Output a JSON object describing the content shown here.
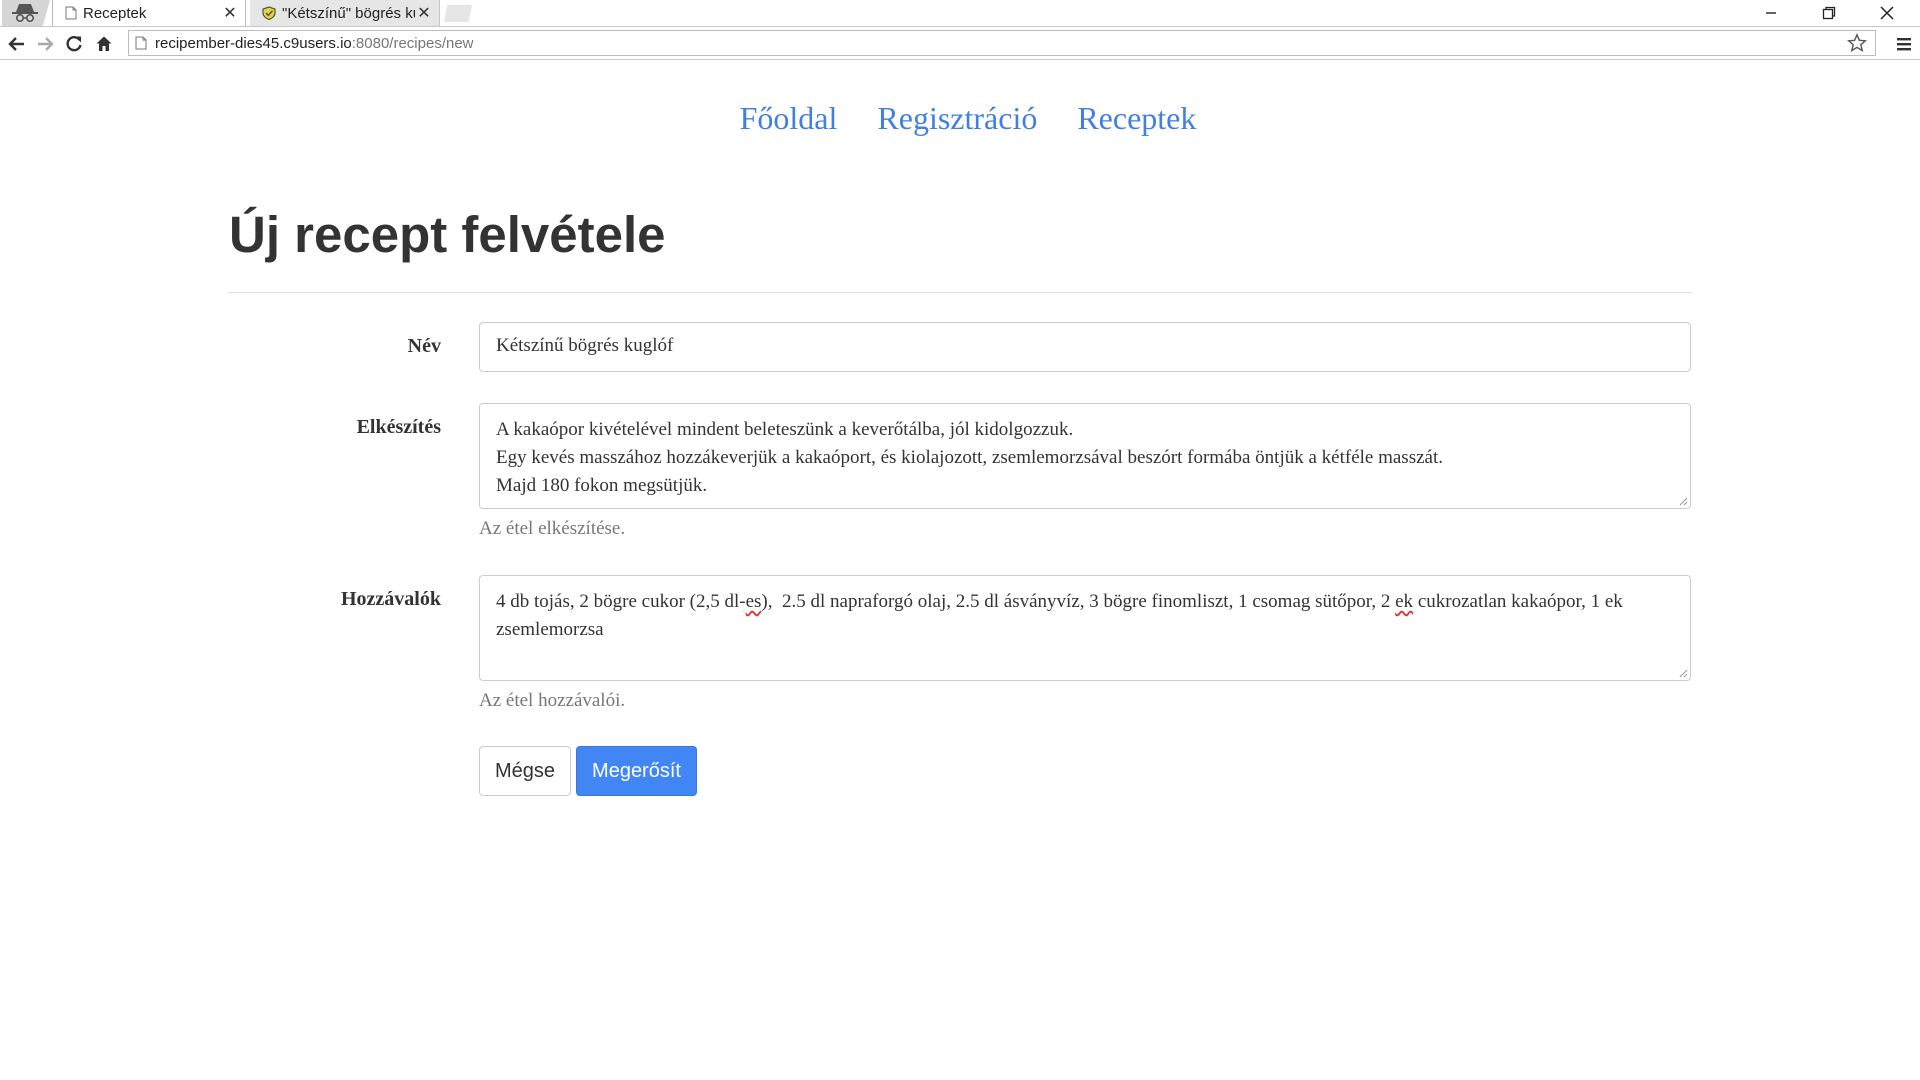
{
  "browser": {
    "tabs": [
      {
        "title": "Receptek",
        "active": true
      },
      {
        "title": "\"Kétszínű\" bögrés ku",
        "active": false
      }
    ],
    "url_host": "recipember-dies45.c9users.io",
    "url_rest": ":8080/recipes/new"
  },
  "nav": {
    "items": [
      "Főoldal",
      "Regisztráció",
      "Receptek"
    ]
  },
  "page": {
    "title": "Új recept felvétele"
  },
  "form": {
    "name": {
      "label": "Név",
      "value": "Kétszínű bögrés kuglóf"
    },
    "preparation": {
      "label": "Elkészítés",
      "lines": [
        "A kakaópor kivételével mindent beleteszünk a keverőtálba, jól kidolgozzuk.",
        "Egy kevés masszához hozzákeverjük a kakaóport, és kiolajozott, zsemlemorzsával beszórt formába öntjük a kétféle masszát.",
        "Majd 180 fokon megsütjük."
      ],
      "help": "Az étel elkészítése."
    },
    "ingredients": {
      "label": "Hozzávalók",
      "value_before": "4 db tojás, 2 bögre cukor (2,5 dl-",
      "value_spell1": "es",
      "value_mid": "),  2.5 dl napraforgó olaj, 2.5 dl ásványvíz, 3 bögre finomliszt, 1 csomag sütőpor, 2 ",
      "value_spell2": "ek",
      "value_after": " cukrozatlan kakaópor, 1 ek zsemlemorzsa",
      "help": "Az étel hozzávalói."
    },
    "cancel_label": "Mégse",
    "submit_label": "Megerősít"
  },
  "colors": {
    "link": "#4080e6",
    "primary": "#4285f4"
  }
}
